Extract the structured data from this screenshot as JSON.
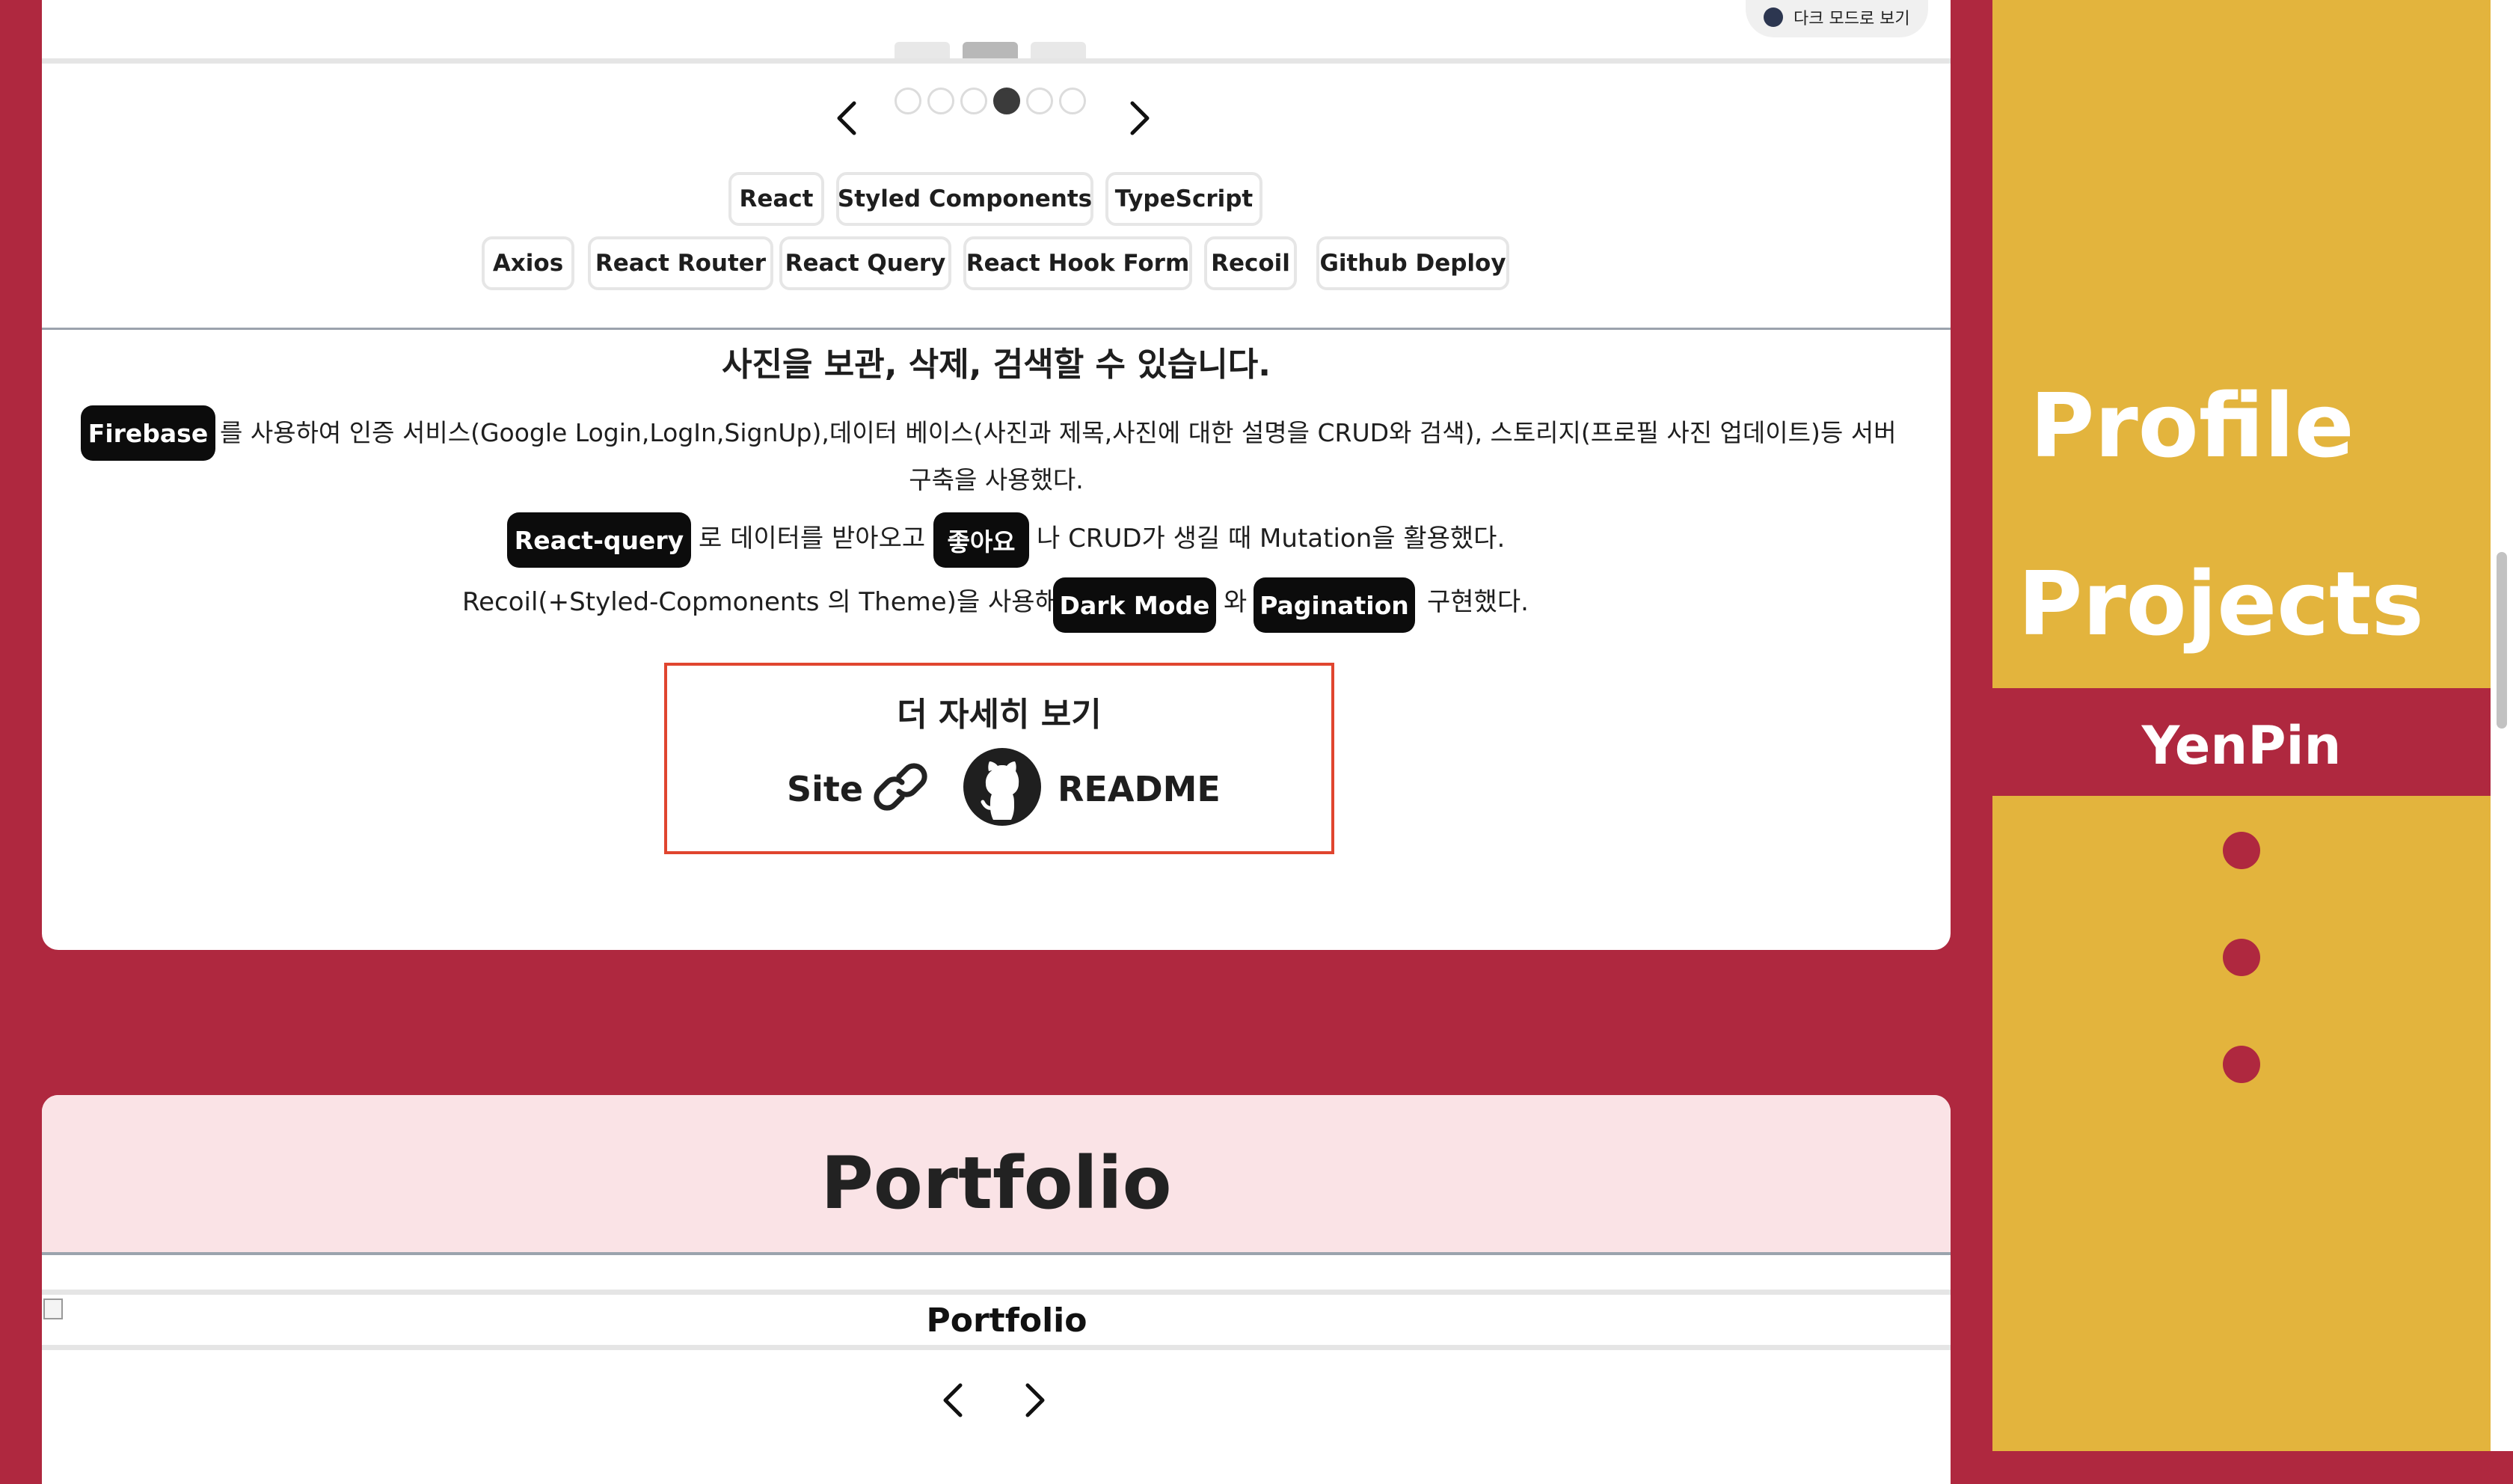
{
  "theme": {
    "accent": "#af283f",
    "sidebar_bg": "#e3b43d",
    "card_bg": "#ffffff",
    "portfolio_header_bg": "#fae3e6",
    "keyword_bg": "#0c0c0c",
    "highlight_border": "#e0452f"
  },
  "top_toggle": {
    "label": "다크 모드로 보기",
    "icon": "moon-icon"
  },
  "carousel": {
    "slide_count": 6,
    "active_index": 3,
    "prev_icon": "chevron-left-icon",
    "next_icon": "chevron-right-icon"
  },
  "tech_stack": {
    "row1": [
      "React",
      "Styled Components",
      "TypeScript"
    ],
    "row2": [
      "Axios",
      "React Router",
      "React Query",
      "React Hook Form",
      "Recoil",
      "Github Deploy"
    ]
  },
  "project": {
    "headline": "사진을 보관, 삭제, 검색할 수 있습니다.",
    "line1": {
      "keyword": "Firebase",
      "text": "를 사용하여 인증 서비스(Google Login,LogIn,SignUp),데이터 베이스(사진과 제목,사진에 대한 설명을 CRUD와 검색), 스토리지(프로필 사진 업데이트)등 서버"
    },
    "line1b": "구축을 사용했다.",
    "line2": {
      "keyword1": "React-query",
      "text1": "로 데이터를 받아오고",
      "keyword2": "좋아요",
      "text2": "나 CRUD가 생길 때 Mutation을 활용했다."
    },
    "line3": {
      "text1": "Recoil(+Styled-Copmonents 의 Theme)을 사용해",
      "keyword1": "Dark Mode",
      "text2": "와",
      "keyword2": "Pagination",
      "text3": "구현했다."
    },
    "more": {
      "title": "더 자세히 보기",
      "site_label": "Site",
      "site_icon": "link-icon",
      "readme_label": "README",
      "readme_icon": "github-icon"
    }
  },
  "portfolio": {
    "title": "Portfolio",
    "image_alt": "Portfolio",
    "prev_icon": "chevron-left-icon",
    "next_icon": "chevron-right-icon"
  },
  "sidebar": {
    "items": [
      "Profile",
      "Projects",
      "YenPin"
    ],
    "dot_count": 3
  }
}
